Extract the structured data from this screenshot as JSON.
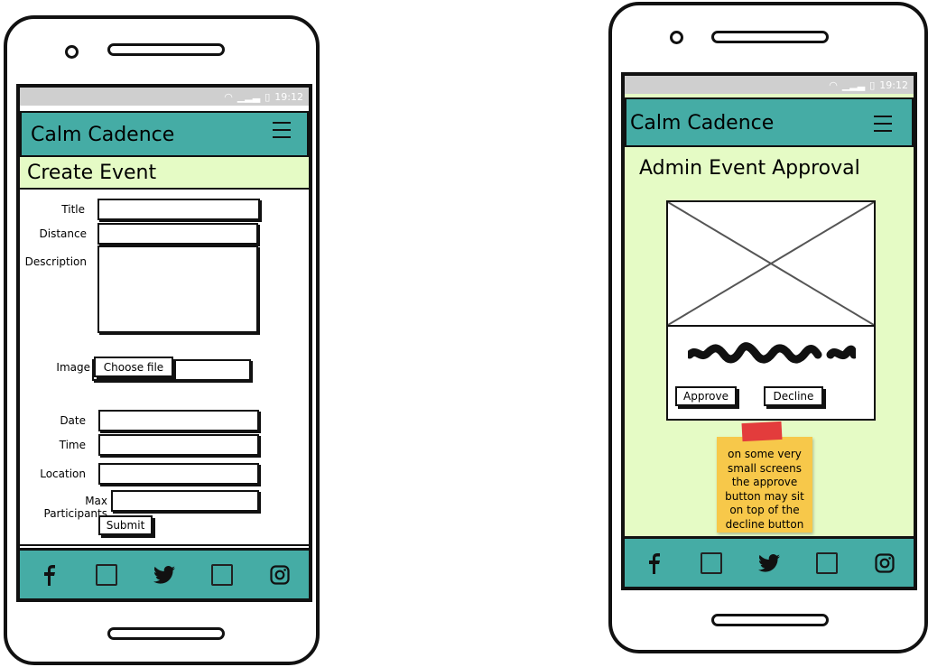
{
  "brand": "Calm Cadence",
  "status": {
    "time": "19:12"
  },
  "create": {
    "title": "Create Event",
    "labels": {
      "title": "Title",
      "distance": "Distance",
      "description": "Description",
      "image": "Image",
      "date": "Date",
      "time": "Time",
      "location": "Location",
      "max_participants": "Max Participants"
    },
    "choose_file": "Choose file",
    "submit": "Submit"
  },
  "admin": {
    "title": "Admin Event Approval",
    "approve": "Approve",
    "decline": "Decline",
    "note": "on some very small screens the approve button may sit on top of the decline button"
  },
  "footer_icons": [
    "facebook-icon",
    "square-icon",
    "twitter-icon",
    "square-icon",
    "instagram-icon"
  ],
  "colors": {
    "teal": "#45aca5",
    "light_green": "#e5fbc5",
    "note_yellow": "#f7c84a",
    "tape_red": "#e33c3c"
  }
}
